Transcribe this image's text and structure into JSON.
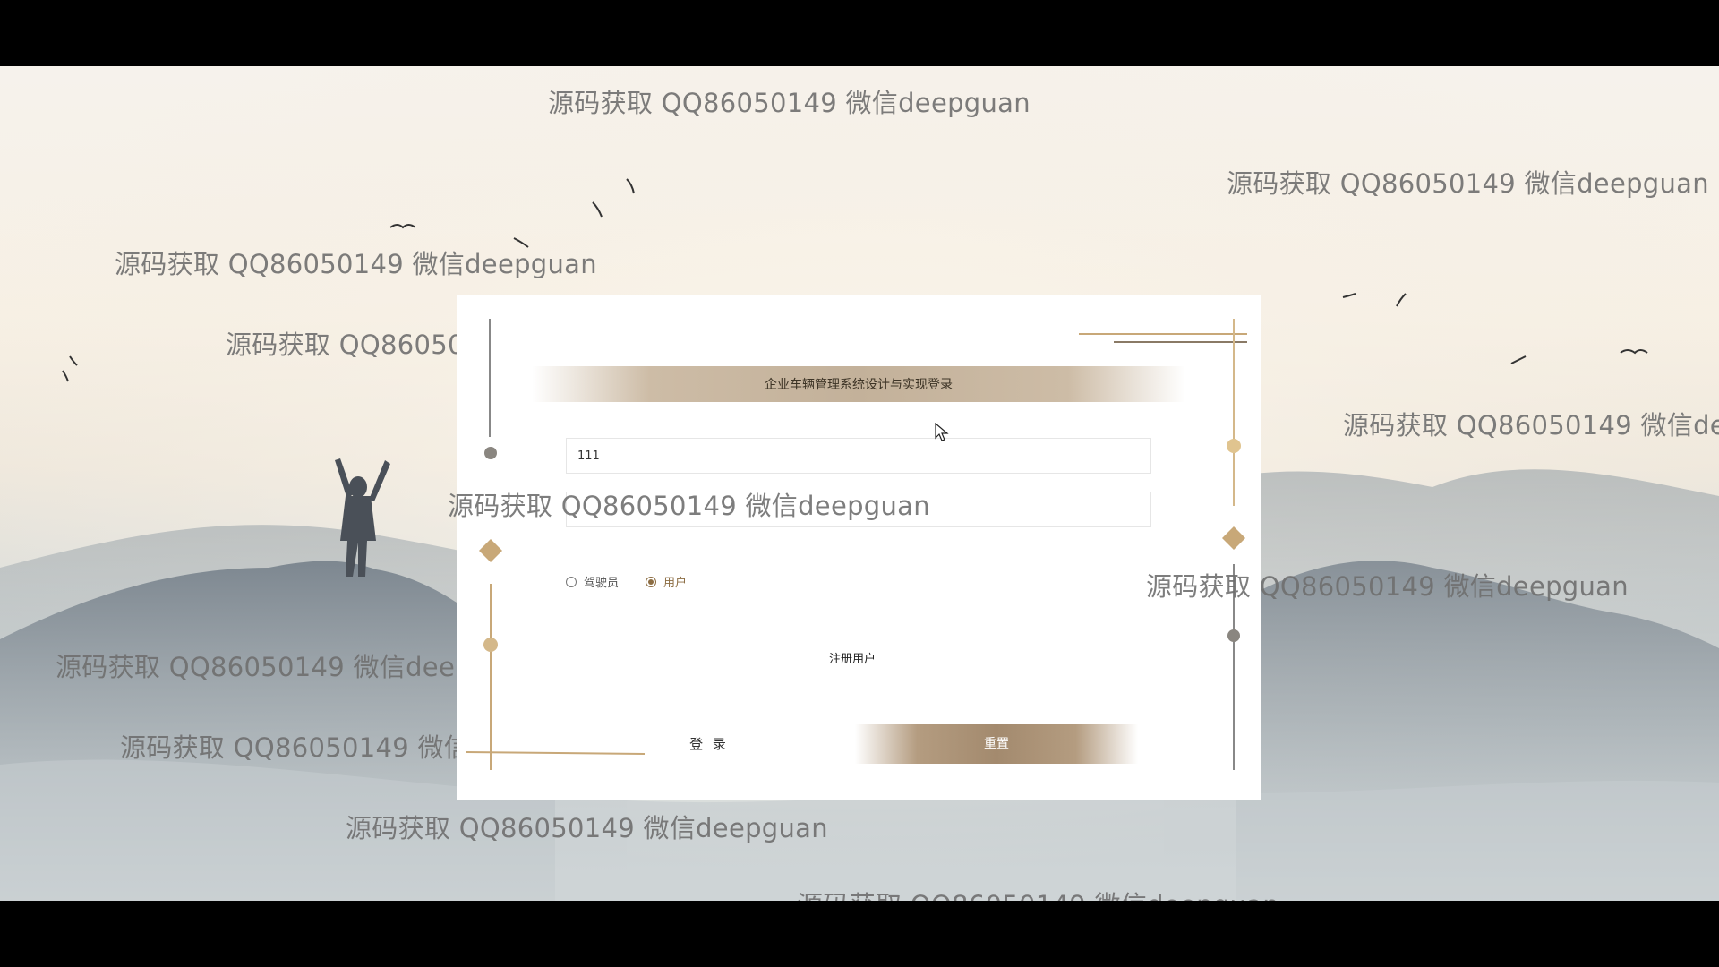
{
  "login": {
    "title": "企业车辆管理系统设计与实现登录",
    "username_value": "111",
    "password_value": "",
    "roles": [
      {
        "label": "驾驶员",
        "selected": false
      },
      {
        "label": "用户",
        "selected": true
      }
    ],
    "register_link": "注册用户",
    "login_button": "登 录",
    "reset_button": "重置"
  },
  "watermark_text": "源码获取 QQ86050149 微信deepguan",
  "colors": {
    "accent_gold": "#c8a878",
    "accent_brown": "#8c6d43",
    "card_bg": "#ffffff"
  }
}
